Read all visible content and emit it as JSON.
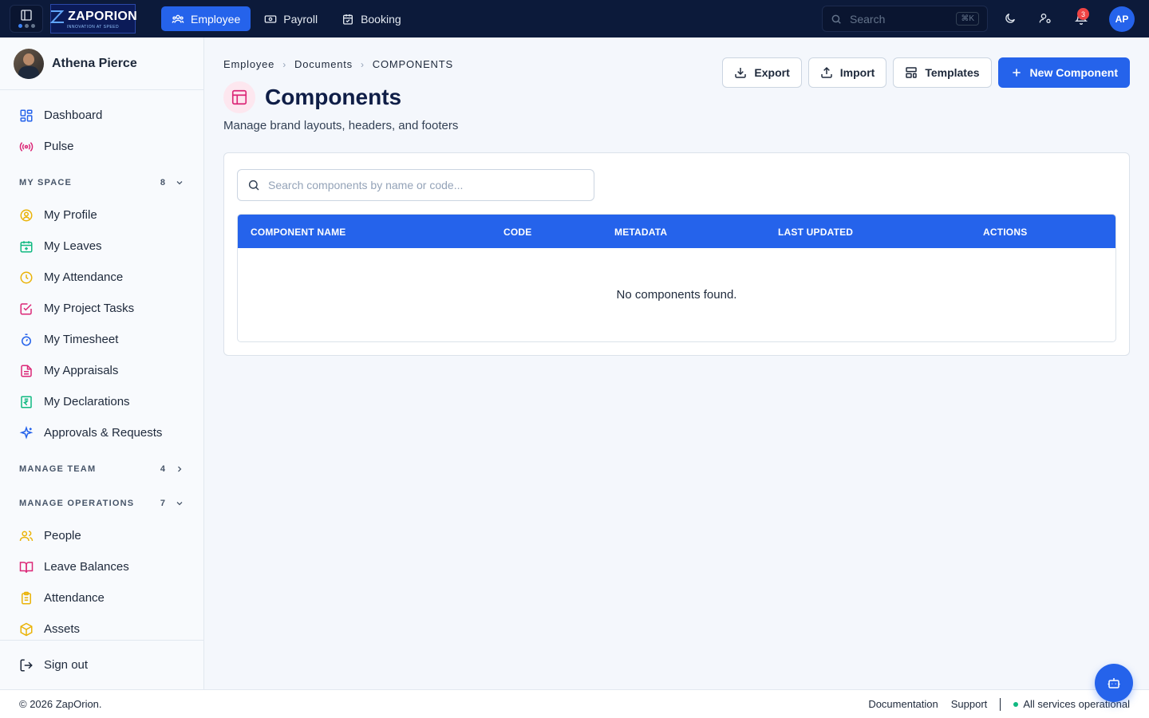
{
  "app": {
    "brand_name": "ZAPORION",
    "brand_tagline": "INNOVATION AT SPEED"
  },
  "topnav": {
    "items": [
      {
        "label": "Employee",
        "icon": "users-icon",
        "active": true
      },
      {
        "label": "Payroll",
        "icon": "banknote-icon",
        "active": false
      },
      {
        "label": "Booking",
        "icon": "calendar-check-icon",
        "active": false
      }
    ],
    "search_placeholder": "Search",
    "search_shortcut": "⌘K",
    "notification_count": "3",
    "avatar_initials": "AP"
  },
  "sidebar": {
    "user_name": "Athena Pierce",
    "top_items": [
      {
        "label": "Dashboard",
        "icon": "grid-icon"
      },
      {
        "label": "Pulse",
        "icon": "radio-icon"
      }
    ],
    "sections": [
      {
        "title": "MY SPACE",
        "count": "8",
        "expanded": true,
        "items": [
          {
            "label": "My Profile",
            "icon": "user-circle-icon"
          },
          {
            "label": "My Leaves",
            "icon": "calendar-plus-icon"
          },
          {
            "label": "My Attendance",
            "icon": "clock-icon"
          },
          {
            "label": "My Project Tasks",
            "icon": "checkbox-icon"
          },
          {
            "label": "My Timesheet",
            "icon": "timer-icon"
          },
          {
            "label": "My Appraisals",
            "icon": "file-text-icon"
          },
          {
            "label": "My Declarations",
            "icon": "rupee-receipt-icon"
          },
          {
            "label": "Approvals & Requests",
            "icon": "sparkles-icon"
          }
        ]
      },
      {
        "title": "MANAGE TEAM",
        "count": "4",
        "expanded": false,
        "items": []
      },
      {
        "title": "MANAGE OPERATIONS",
        "count": "7",
        "expanded": true,
        "items": [
          {
            "label": "People",
            "icon": "people-icon"
          },
          {
            "label": "Leave Balances",
            "icon": "book-open-icon"
          },
          {
            "label": "Attendance",
            "icon": "clipboard-icon"
          },
          {
            "label": "Assets",
            "icon": "package-icon"
          }
        ]
      }
    ],
    "signout_label": "Sign out"
  },
  "main": {
    "breadcrumb": [
      "Employee",
      "Documents",
      "COMPONENTS"
    ],
    "title": "Components",
    "subtitle": "Manage brand layouts, headers, and footers",
    "actions": {
      "export": "Export",
      "import": "Import",
      "templates": "Templates",
      "new": "New Component"
    },
    "search_placeholder": "Search components by name or code...",
    "table": {
      "columns": [
        "COMPONENT NAME",
        "CODE",
        "METADATA",
        "LAST UPDATED",
        "ACTIONS"
      ],
      "empty_message": "No components found."
    }
  },
  "footer": {
    "copyright": "© 2026 ZapOrion.",
    "links": [
      "Documentation",
      "Support"
    ],
    "status": "All services operational"
  },
  "colors": {
    "topbar": "#0c1a3a",
    "accent": "#2563eb",
    "status_ok": "#10b981",
    "badge": "#ef4444"
  }
}
